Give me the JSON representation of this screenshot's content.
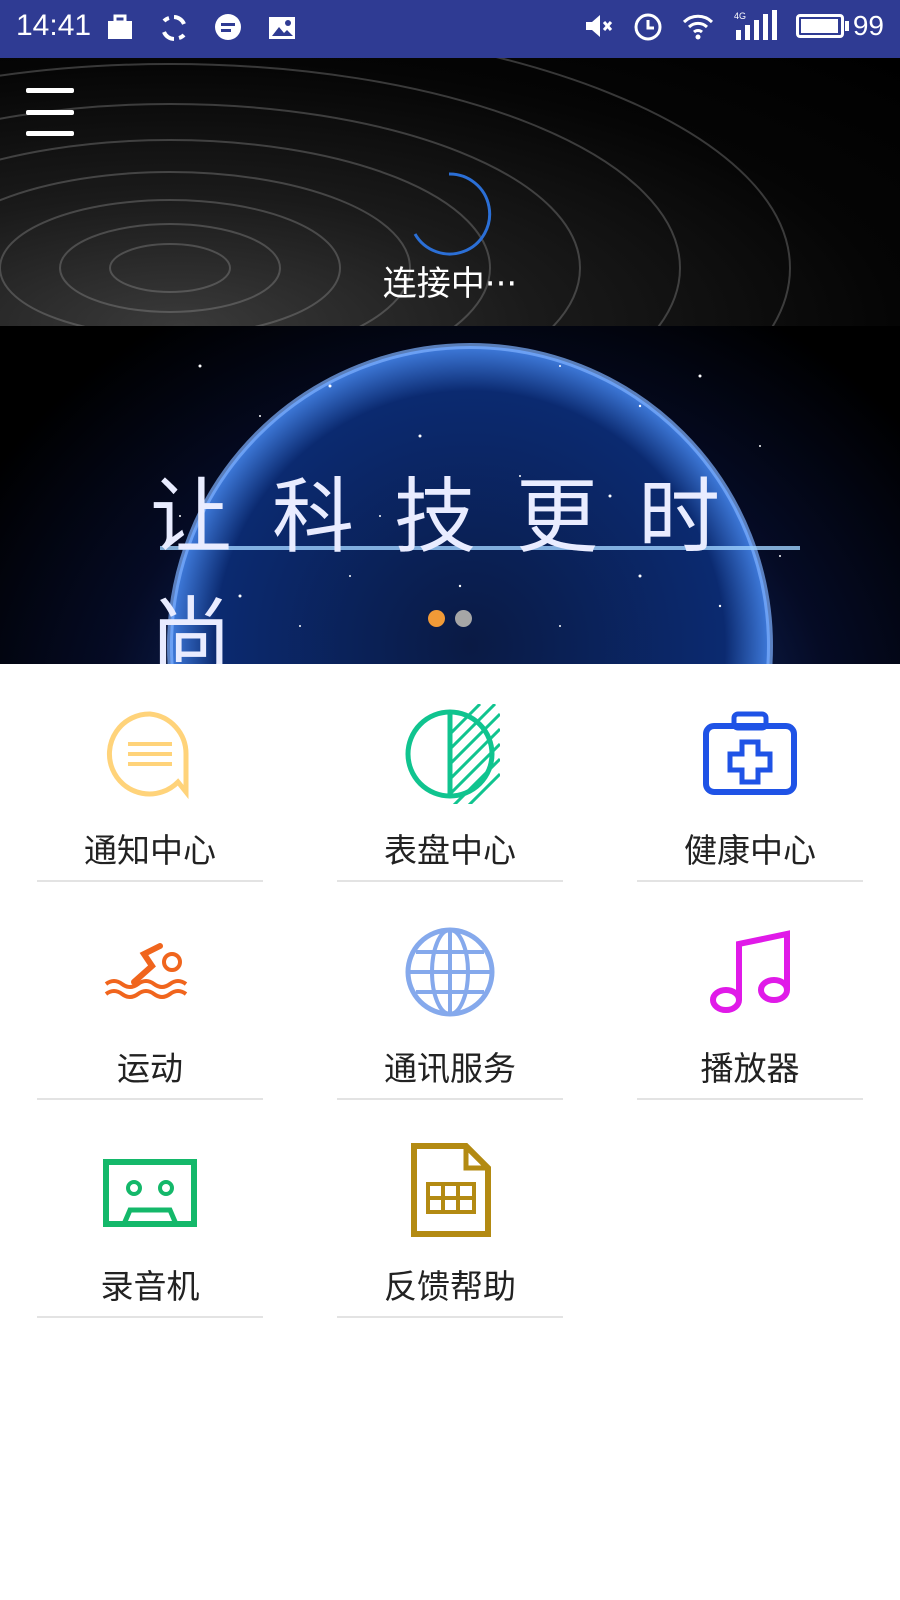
{
  "status_bar": {
    "time": "14:41",
    "battery_level": "99",
    "battery_fraction": 0.99,
    "left_icons": [
      "briefcase-icon",
      "sync-icon",
      "chat-icon",
      "gallery-icon"
    ],
    "right_icons": [
      "mute-icon",
      "alarm-icon",
      "wifi-icon",
      "signal-4g-icon"
    ],
    "network_type": "4G",
    "bg_color": "#2f3b93"
  },
  "header": {
    "connecting_text": "连接中···",
    "spinner_color": "#2b6fd6"
  },
  "banner": {
    "title": "让科技更时尚",
    "page_indicator": {
      "count": 2,
      "active_index": 0,
      "active_color": "#f19a37",
      "inactive_color": "#a6a6a6"
    }
  },
  "tiles": [
    {
      "label": "通知中心",
      "icon": "message-icon",
      "color": "#ffd37a"
    },
    {
      "label": "表盘中心",
      "icon": "watch-face-icon",
      "color": "#10c48f"
    },
    {
      "label": "健康中心",
      "icon": "medical-kit-icon",
      "color": "#1f53e6"
    },
    {
      "label": "运动",
      "icon": "swimming-icon",
      "color": "#f0651d"
    },
    {
      "label": "通讯服务",
      "icon": "globe-icon",
      "color": "#85a9ec"
    },
    {
      "label": "播放器",
      "icon": "music-note-icon",
      "color": "#e01ae8"
    },
    {
      "label": "录音机",
      "icon": "cassette-icon",
      "color": "#14b86a"
    },
    {
      "label": "反馈帮助",
      "icon": "document-icon",
      "color": "#b38a12"
    }
  ]
}
